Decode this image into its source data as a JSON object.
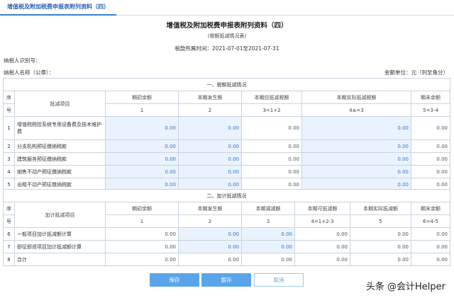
{
  "tab": {
    "label": "增值税及附加税费申报表附列资料（四）"
  },
  "header": {
    "title": "增值税及附加税费申报表附列资料（四）",
    "subtitle": "(税额抵减情况表)",
    "period": "税款所属时间：2021-07-01至2021-07-31",
    "taxpayer_id_label": "纳税人识别号：",
    "taxpayer_name_label": "纳税人名称（公章）：",
    "unit": "金额单位：元（列至角分）"
  },
  "section1": {
    "title": "一、税额抵减情况",
    "seq_top": "序",
    "seq_bottom": "号",
    "item_header": "抵减项目",
    "columns": [
      "期初余额",
      "本期发生额",
      "本期应抵减税额",
      "本期实际抵减税额",
      "期末余额"
    ],
    "formulas": [
      "1",
      "2",
      "3=1+2",
      "4≤=3",
      "5=3-4"
    ],
    "rows": [
      {
        "no": "1",
        "label": "增值税税控系统专用设备费及技术维护费",
        "values": [
          "0.00",
          "0.00",
          "0.00",
          "0.00",
          "0.00"
        ]
      },
      {
        "no": "2",
        "label": "分支机构预征缴纳税款",
        "values": [
          "0.00",
          "0.00",
          "0.00",
          "0.00",
          "0.00"
        ]
      },
      {
        "no": "3",
        "label": "建筑服务预征缴纳税款",
        "values": [
          "0.00",
          "0.00",
          "0.00",
          "0.00",
          "0.00"
        ]
      },
      {
        "no": "4",
        "label": "销售不动产预征缴纳税款",
        "values": [
          "0.00",
          "0.00",
          "0.00",
          "0.00",
          "0.00"
        ]
      },
      {
        "no": "5",
        "label": "出租不动产预征缴纳税款",
        "values": [
          "0.00",
          "0.00",
          "0.00",
          "0.00",
          "0.00"
        ]
      }
    ]
  },
  "section2": {
    "title": "二、加计抵减情况",
    "seq_top": "序",
    "seq_bottom": "号",
    "item_header": "加计抵减项目",
    "columns": [
      "期初余额",
      "本期发生额",
      "本期调减额",
      "本期可抵减额",
      "本期实际抵减额",
      "期末余额"
    ],
    "formulas": [
      "1",
      "2",
      "3",
      "4=1+2-3",
      "5",
      "6=4-5"
    ],
    "rows": [
      {
        "no": "6",
        "label": "一般项目加计抵减额计算",
        "values": [
          "0.00",
          "0.00",
          "0.00",
          "0.00",
          "0.00",
          "0.00"
        ]
      },
      {
        "no": "7",
        "label": "即征即退项目加计抵减额计算",
        "values": [
          "0.00",
          "0.00",
          "0.00",
          "0.00",
          "0.00",
          "0.00"
        ]
      },
      {
        "no": "8",
        "label": "合计",
        "values": [
          "0.00",
          "0.00",
          "0.00",
          "0.00",
          "0.00",
          "0.00"
        ]
      }
    ]
  },
  "buttons": {
    "save": "保存",
    "draft": "暂存",
    "cancel": "取消"
  },
  "watermark": "头条 @会计Helper"
}
